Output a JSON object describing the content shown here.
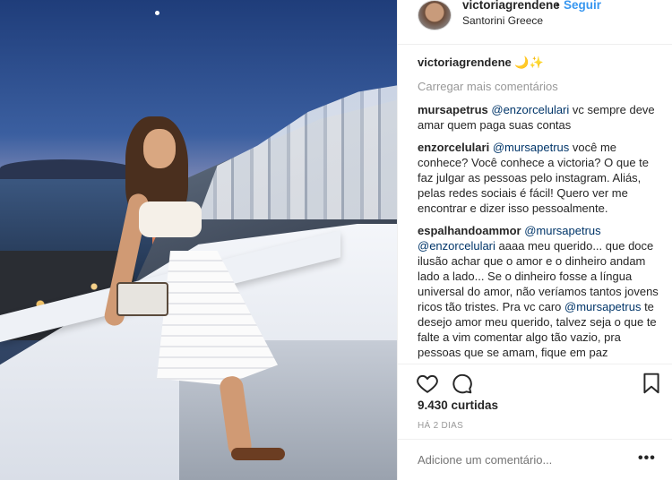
{
  "post": {
    "username": "victoriagrendene",
    "separator": "•",
    "follow_label": "Seguir",
    "location": "Santorini Greece",
    "caption_user": "victoriagrendene",
    "caption_text": "🌙✨",
    "load_more": "Carregar mais comentários",
    "comments": [
      {
        "user": "mursapetrus",
        "mention": "@enzorcelulari",
        "text": " vc sempre deve amar quem paga suas contas"
      },
      {
        "user": "enzorcelulari",
        "mention": "@mursapetrus",
        "text": " você me conhece? Você conhece a victoria? O que te faz julgar as pessoas pelo instagram. Aliás, pelas redes sociais é fácil! Quero ver me encontrar e dizer isso pessoalmente."
      },
      {
        "user": "espalhandoammor",
        "mention": "@mursapetrus",
        "mention2": "@enzorcelulari",
        "text": " aaaa meu querido... que doce ilusão achar que o amor e o dinheiro andam lado a lado... Se o dinheiro fosse a língua universal do amor, não veríamos tantos jovens ricos tão tristes. Pra vc caro ",
        "mention3": "@mursapetrus",
        "text2": " te desejo amor meu querido, talvez seja o que te falte a vim comentar algo tão vazio, pra pessoas que se amam, fique em paz"
      }
    ],
    "likes": "9.430 curtidas",
    "time": "HÁ 2 DIAS",
    "add_comment_placeholder": "Adicione um comentário...",
    "more_label": "•••"
  },
  "icons": {
    "heart": "heart-icon",
    "comment": "comment-icon",
    "bookmark": "bookmark-icon",
    "more": "more-options-icon"
  },
  "colors": {
    "link_blue": "#3897f0",
    "mention": "#003569",
    "muted": "#999999"
  }
}
